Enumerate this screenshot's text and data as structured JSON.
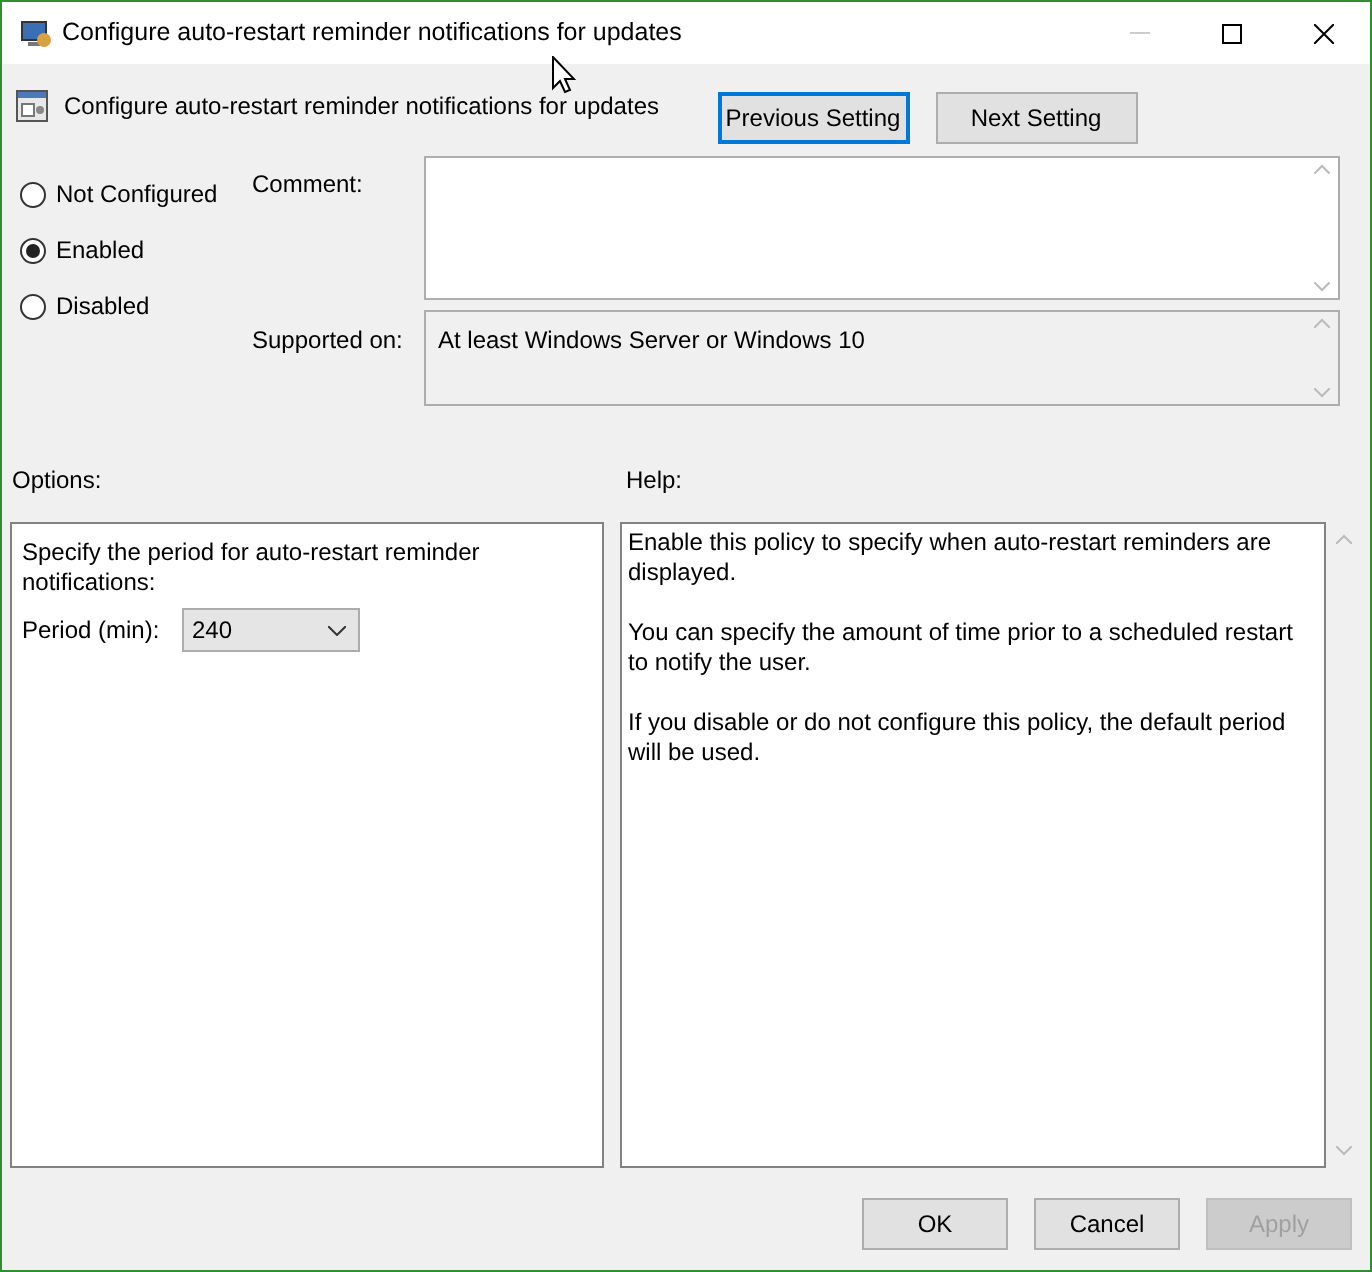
{
  "window": {
    "title": "Configure auto-restart reminder notifications for updates"
  },
  "header": {
    "title": "Configure auto-restart reminder notifications for updates"
  },
  "nav_buttons": [
    {
      "label": "Previous Setting",
      "focused": true
    },
    {
      "label": "Next Setting",
      "focused": false
    }
  ],
  "state_options": [
    {
      "label": "Not Configured",
      "selected": false
    },
    {
      "label": "Enabled",
      "selected": true
    },
    {
      "label": "Disabled",
      "selected": false
    }
  ],
  "comment": {
    "label": "Comment:"
  },
  "supported_on": {
    "label": "Supported on:",
    "value": "At least Windows Server or Windows 10"
  },
  "options": {
    "heading": "Options:",
    "description": "Specify the period for auto-restart reminder notifications:",
    "period_label": "Period (min):",
    "period_value": "240"
  },
  "help": {
    "heading": "Help:",
    "paragraphs": [
      "Enable this policy to specify when auto-restart reminders are displayed.",
      "You can specify the amount of time prior to a scheduled restart to notify the user.",
      "If you disable or do not configure this policy, the default period will be used."
    ]
  },
  "buttons": [
    {
      "label": "OK",
      "disabled": false
    },
    {
      "label": "Cancel",
      "disabled": false
    },
    {
      "label": "Apply",
      "disabled": true
    }
  ]
}
